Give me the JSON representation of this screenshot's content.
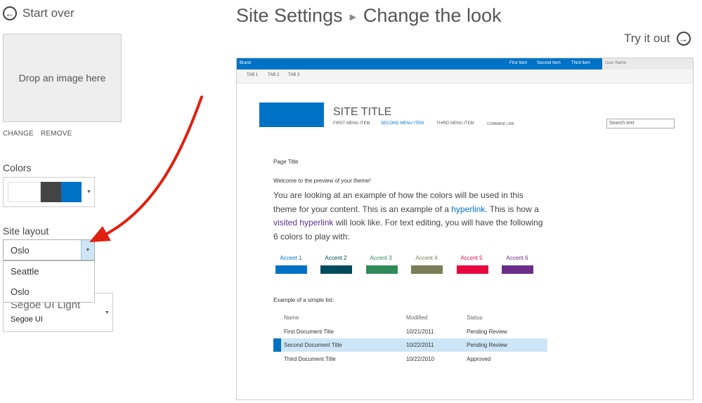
{
  "left_panel": {
    "start_over": "Start over",
    "drop_image": "Drop an image here",
    "change": "CHANGE",
    "remove": "REMOVE",
    "colors_label": "Colors",
    "color_swatches": [
      "#ffffff",
      "#444444",
      "#0072c6"
    ],
    "site_layout_label": "Site layout",
    "layout_selected": "Oslo",
    "layout_options": [
      "Seattle",
      "Oslo"
    ],
    "font_heading": "Segoe UI Light",
    "font_body": "Segoe UI"
  },
  "header": {
    "crumb1": "Site Settings",
    "crumb2": "Change the look",
    "try_it_out": "Try it out"
  },
  "preview": {
    "brand": "Brand",
    "suite_links": [
      "First Item",
      "Second Item",
      "Third Item"
    ],
    "user_name": "User Name",
    "tabs": [
      "TAB 1",
      "TAB 2",
      "TAB 3"
    ],
    "site_title": "SITE TITLE",
    "top_nav": [
      "FIRST MENU ITEM",
      "SECOND MENU ITEM",
      "THIRD MENU ITEM",
      "COMMAND LINK"
    ],
    "search_placeholder": "Search text",
    "page_title": "Page Title",
    "welcome": "Welcome to the preview of your theme!",
    "body": {
      "p1": "You are looking at an example of how the colors will be used in this theme for your content. This is an example of a ",
      "hyperlink": "hyperlink",
      "p2": ". This is how a ",
      "visited": "visited hyperlink",
      "p3": " will look like. For text editing, you will have the following 6 colors to play with:"
    },
    "accents": [
      {
        "label": "Accent 1",
        "color": "#0072c6"
      },
      {
        "label": "Accent 2",
        "color": "#004b5e"
      },
      {
        "label": "Accent 3",
        "color": "#2e8b57"
      },
      {
        "label": "Accent 4",
        "color": "#7a7d55"
      },
      {
        "label": "Accent 5",
        "color": "#e8083e"
      },
      {
        "label": "Accent 6",
        "color": "#6c2c8a"
      }
    ],
    "list_caption": "Example of a simple list:",
    "list_headers": [
      "Name",
      "Modified",
      "Status"
    ],
    "list_rows": [
      {
        "name": "First Document Title",
        "modified": "10/21/2011",
        "status": "Pending Review"
      },
      {
        "name": "Second Document Title",
        "modified": "10/22/2011",
        "status": "Pending Review"
      },
      {
        "name": "Third Document Title",
        "modified": "10/22/2010",
        "status": "Approved"
      }
    ]
  },
  "colors": {
    "accent": "#0072c6",
    "arrow": "#e02010"
  }
}
